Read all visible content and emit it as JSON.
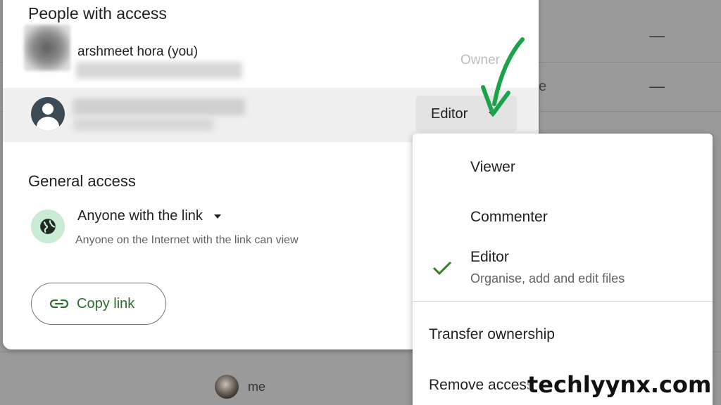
{
  "background": {
    "row_partial_text": "e",
    "dash_1": "—",
    "dash_2": "—",
    "owner_name": "me"
  },
  "dialog": {
    "people_title": "People with access",
    "owner": {
      "name": "arshmeet hora (you)",
      "role": "Owner"
    },
    "collaborator": {
      "role": "Editor"
    },
    "general_title": "General access",
    "link_access": {
      "selected": "Anyone with the link",
      "description": "Anyone on the Internet with the link can view",
      "icon": "globe-icon"
    },
    "copy_link_label": "Copy link"
  },
  "menu": {
    "items": [
      {
        "label": "Viewer"
      },
      {
        "label": "Commenter"
      },
      {
        "label": "Editor",
        "description": "Organise, add and edit files",
        "selected": true
      }
    ],
    "transfer_label": "Transfer ownership",
    "remove_label": "Remove access"
  },
  "watermark": "techlyynx.com",
  "colors": {
    "accent_green": "#2e6b2f",
    "arrow_green": "#1aa34a",
    "check_green": "#3a7d2c"
  }
}
